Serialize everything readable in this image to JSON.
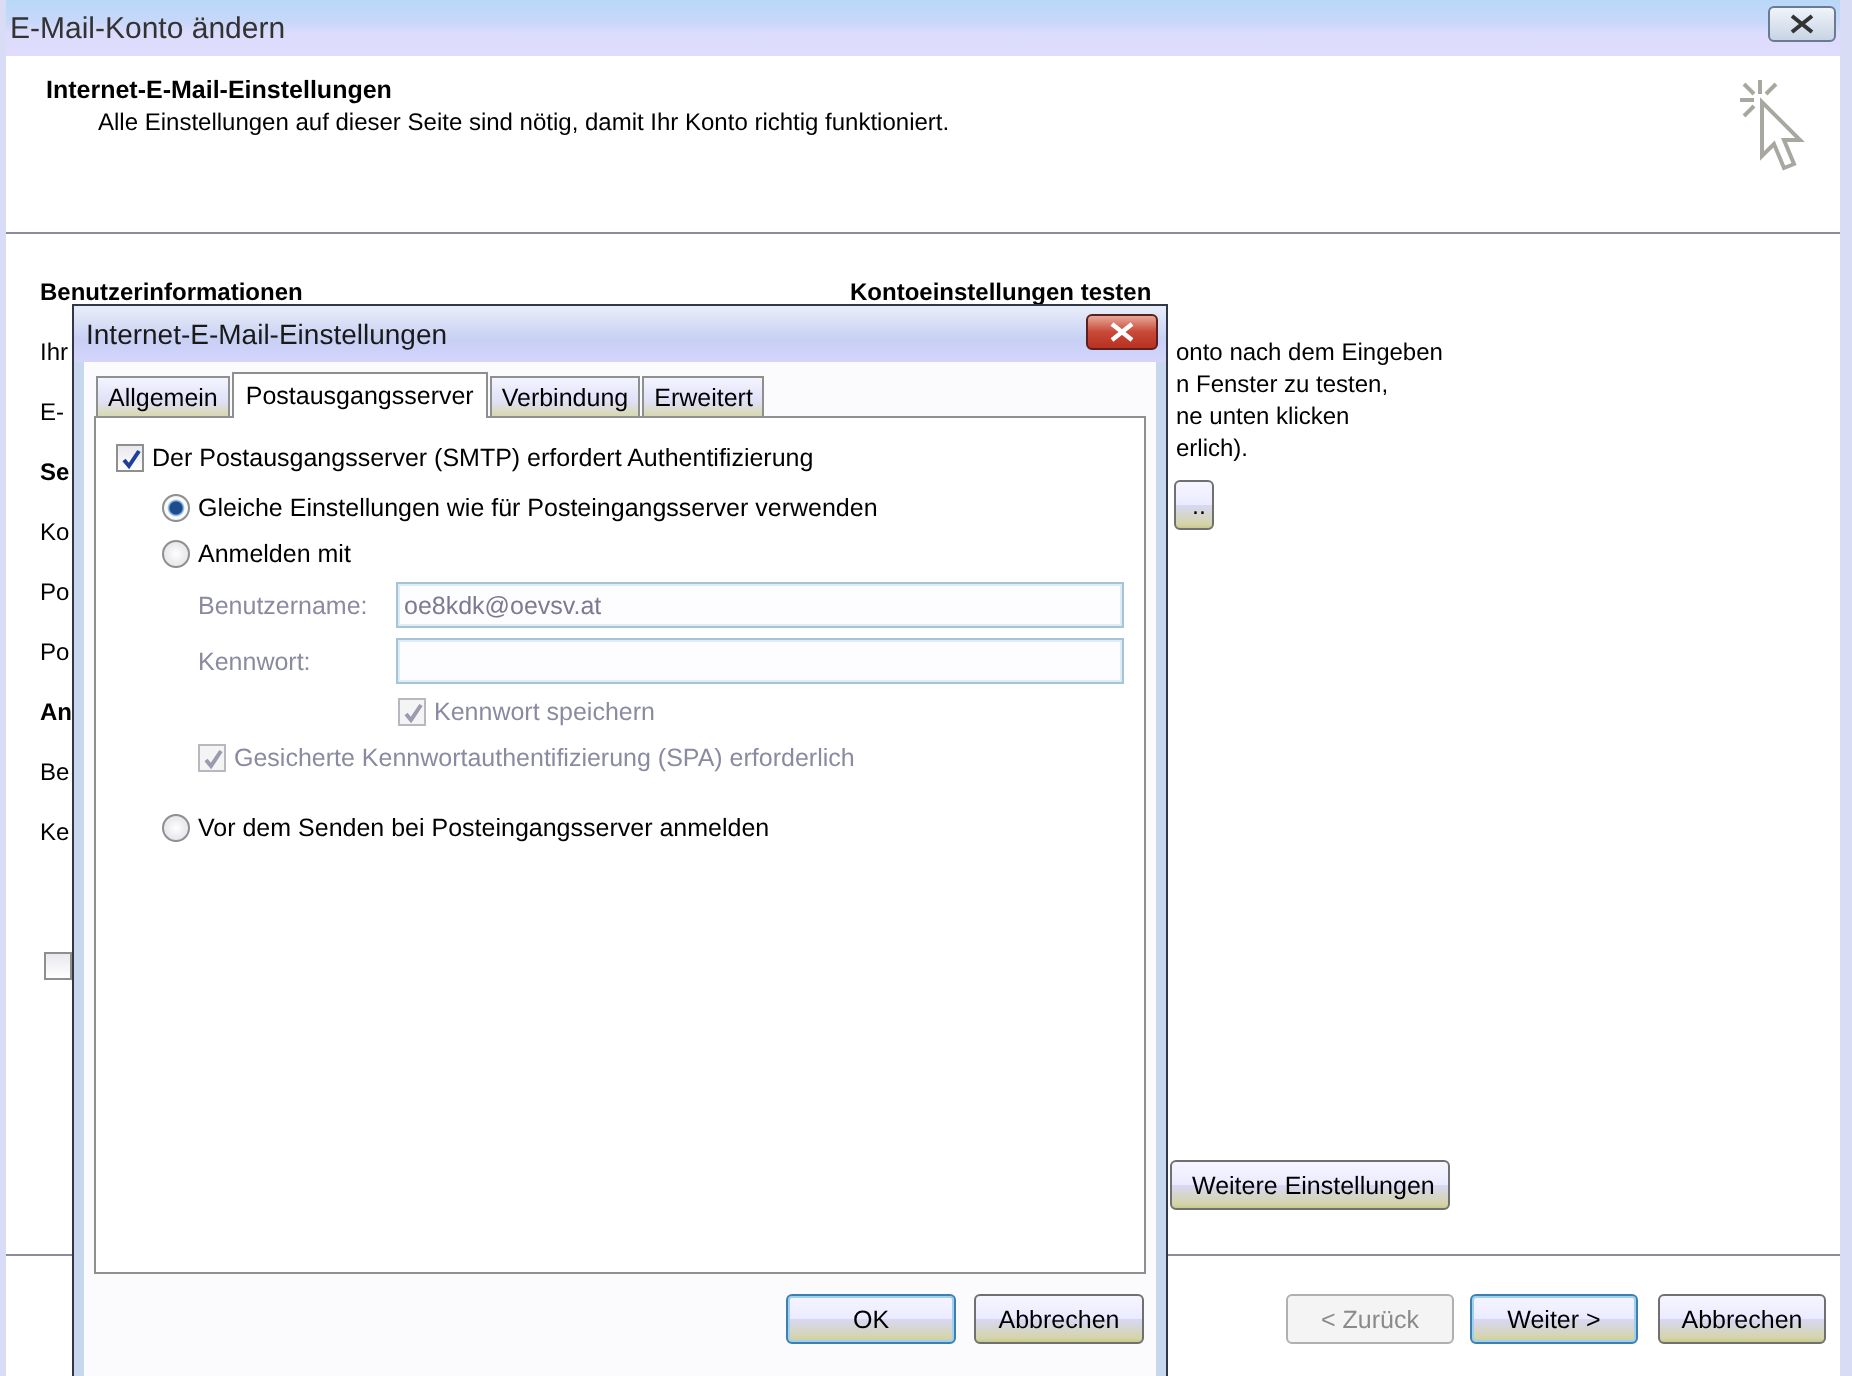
{
  "window": {
    "title": "E-Mail-Konto ändern"
  },
  "header": {
    "title": "Internet-E-Mail-Einstellungen",
    "subtitle": "Alle Einstellungen auf dieser Seite sind nötig, damit Ihr Konto richtig funktioniert."
  },
  "left_section": {
    "items": [
      {
        "kind": "heading",
        "text": "Benutzerinformationen"
      },
      {
        "kind": "label",
        "text": "Ihr"
      },
      {
        "kind": "label",
        "text": "E-"
      },
      {
        "kind": "heading",
        "text": "Se"
      },
      {
        "kind": "label",
        "text": "Ko"
      },
      {
        "kind": "label",
        "text": "Po"
      },
      {
        "kind": "label",
        "text": "Po"
      },
      {
        "kind": "heading",
        "text": "An"
      },
      {
        "kind": "label",
        "text": "Be"
      },
      {
        "kind": "label",
        "text": "Ke"
      },
      {
        "kind": "checkbox",
        "checked": false
      }
    ]
  },
  "right_section": {
    "heading": "Kontoeinstellungen testen",
    "lines": [
      "onto nach dem Eingeben",
      "n Fenster zu testen,",
      "ne unten klicken",
      "erlich)."
    ],
    "test_button": "..",
    "more_button": "Weitere Einstellungen"
  },
  "footer_buttons": [
    {
      "label": "< Zurück",
      "disabled": true,
      "default": false
    },
    {
      "label": "Weiter >",
      "disabled": false,
      "default": true
    },
    {
      "label": "Abbrechen",
      "disabled": false,
      "default": false
    }
  ],
  "dialog": {
    "title": "Internet-E-Mail-Einstellungen",
    "tabs": [
      {
        "label": "Allgemein",
        "selected": false
      },
      {
        "label": "Postausgangsserver",
        "selected": true
      },
      {
        "label": "Verbindung",
        "selected": false
      },
      {
        "label": "Erweitert",
        "selected": false
      }
    ],
    "options": [
      {
        "kind": "checkbox",
        "label": "Der Postausgangsserver (SMTP) erfordert Authentifizierung",
        "checked": true,
        "disabled": false,
        "children": [
          {
            "kind": "radio",
            "label": "Gleiche Einstellungen wie für Posteingangsserver verwenden",
            "selected": true,
            "disabled": false
          },
          {
            "kind": "radio",
            "label": "Anmelden mit",
            "selected": false,
            "disabled": false,
            "children": [
              {
                "kind": "field",
                "label": "Benutzername:",
                "value": "oe8kdk@oevsv.at",
                "disabled": true
              },
              {
                "kind": "field",
                "label": "Kennwort:",
                "disabled": true
              },
              {
                "kind": "field_checkbox",
                "label": "Kennwort speichern",
                "checked": true,
                "disabled": true
              },
              {
                "kind": "checkbox",
                "label": "Gesicherte Kennwortauthentifizierung (SPA) erforderlich",
                "checked": true,
                "disabled": true
              }
            ]
          },
          {
            "kind": "radio",
            "label": "Vor dem Senden bei Posteingangsserver anmelden",
            "selected": false,
            "disabled": false
          }
        ]
      }
    ],
    "buttons": [
      {
        "label": "OK",
        "default": true
      },
      {
        "label": "Abbrechen",
        "default": false
      }
    ]
  }
}
